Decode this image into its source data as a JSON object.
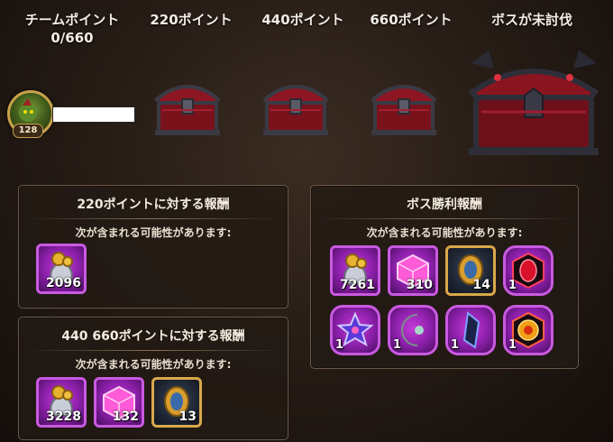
{
  "header": {
    "team_points_label": "チームポイント",
    "team_points_value": "0/660",
    "milestones": [
      "220ポイント",
      "440ポイント",
      "660ポイント"
    ],
    "boss_label": "ボスが未討伐"
  },
  "player": {
    "level": "128"
  },
  "panel_220": {
    "title": "220ポイントに対する報酬",
    "subtitle": "次が含まれる可能性があります:",
    "items": [
      {
        "icon": "coin-bag-icon",
        "qty": "2096"
      }
    ]
  },
  "panel_440": {
    "title": "440 660ポイントに対する報酬",
    "subtitle": "次が含まれる可能性があります:",
    "items": [
      {
        "icon": "coin-bag-icon",
        "qty": "3228"
      },
      {
        "icon": "pink-cube-icon",
        "qty": "132"
      },
      {
        "icon": "gold-ring-orb-icon",
        "qty": "13"
      }
    ]
  },
  "panel_boss": {
    "title": "ボス勝利報酬",
    "subtitle": "次が含まれる可能性があります:",
    "items": [
      {
        "icon": "coin-bag-icon",
        "qty": "7261"
      },
      {
        "icon": "pink-cube-icon",
        "qty": "310"
      },
      {
        "icon": "gold-ring-orb-icon",
        "qty": "14"
      },
      {
        "icon": "red-gem-hexagon-icon",
        "qty": "1"
      },
      {
        "icon": "star-emblem-icon",
        "qty": "1"
      },
      {
        "icon": "crescent-pearl-icon",
        "qty": "1"
      },
      {
        "icon": "dark-crystal-icon",
        "qty": "1"
      },
      {
        "icon": "amber-gem-hexagon-icon",
        "qty": "1"
      }
    ]
  },
  "colors": {
    "purple_frame": "#c95ae0",
    "gold_frame": "#d9a84a",
    "panel_border": "#6a5848"
  }
}
